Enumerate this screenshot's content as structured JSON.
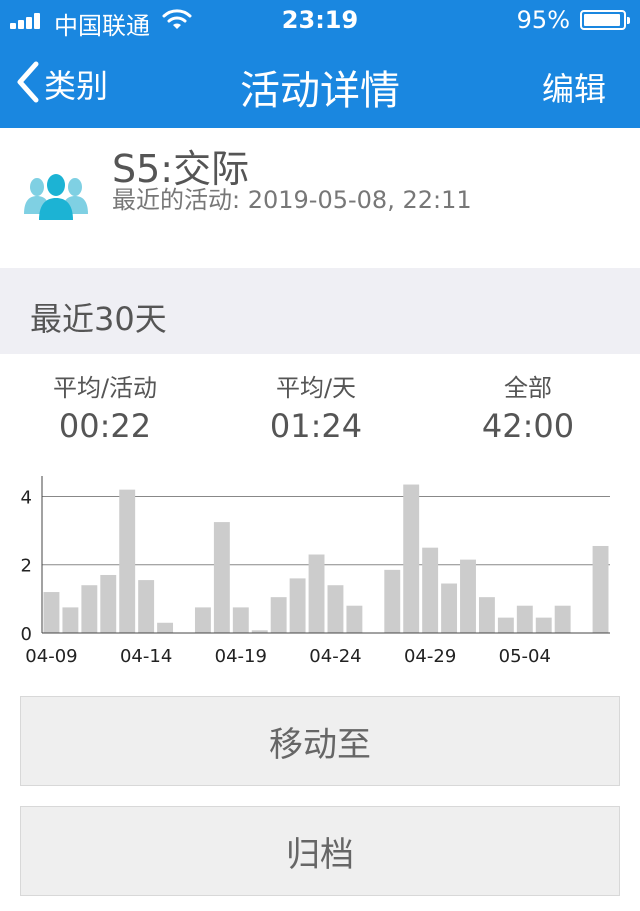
{
  "status_bar": {
    "carrier": "中国联通",
    "time": "23:19",
    "battery_percent": "95%",
    "battery_level": 0.95
  },
  "nav": {
    "back_label": "类别",
    "title": "活动详情",
    "edit_label": "编辑"
  },
  "category": {
    "icon": "group-icon",
    "title": "S5:交际",
    "subtitle": "最近的活动: 2019-05-08, 22:11"
  },
  "section": {
    "label": "最近30天"
  },
  "stats": [
    {
      "label": "平均/活动",
      "value": "00:22"
    },
    {
      "label": "平均/天",
      "value": "01:24"
    },
    {
      "label": "全部",
      "value": "42:00"
    }
  ],
  "chart_data": {
    "type": "bar",
    "x": [
      "04-09",
      "04-10",
      "04-11",
      "04-12",
      "04-13",
      "04-14",
      "04-15",
      "04-16",
      "04-17",
      "04-18",
      "04-19",
      "04-20",
      "04-21",
      "04-22",
      "04-23",
      "04-24",
      "04-25",
      "04-26",
      "04-27",
      "04-28",
      "04-29",
      "04-30",
      "05-01",
      "05-02",
      "05-03",
      "05-04",
      "05-05",
      "05-06",
      "05-07",
      "05-08"
    ],
    "values": [
      1.2,
      0.75,
      1.4,
      1.7,
      4.2,
      1.55,
      0.3,
      0,
      0.75,
      3.25,
      0.75,
      0.08,
      1.05,
      1.6,
      2.3,
      1.4,
      0.8,
      0,
      1.85,
      4.35,
      2.5,
      1.45,
      2.15,
      1.05,
      0.45,
      0.8,
      0.45,
      0.8,
      0,
      2.55
    ],
    "x_tick_labels": [
      "04-09",
      "04-14",
      "04-19",
      "04-24",
      "04-29",
      "05-04"
    ],
    "y_tick_labels": [
      "0",
      "2",
      "4"
    ],
    "ylim": [
      0,
      4.6
    ],
    "grid": true,
    "bar_color": "#cccccc"
  },
  "buttons": {
    "move_label": "移动至",
    "archive_label": "归档"
  },
  "colors": {
    "accent": "#1a87e0",
    "icon": "#1cb3d4"
  }
}
